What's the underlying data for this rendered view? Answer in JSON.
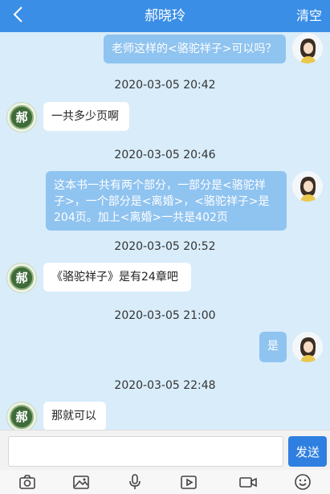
{
  "header": {
    "title": "郝晓玲",
    "clear_label": "清空"
  },
  "messages": [
    {
      "side": "right",
      "text": "老师这样的<骆驼祥子>可以吗？"
    },
    {
      "timestamp": "2020-03-05 20:42",
      "side": "left",
      "avatar_char": "郝",
      "text": "一共多少页啊"
    },
    {
      "timestamp": "2020-03-05 20:46",
      "side": "right",
      "line1": "这本书一共有两个部分，一部分是<骆驼祥",
      "line2": "子>，一个部分是<离婚>，<骆驼祥子>是",
      "line3": "204页。加上<离婚>一共是402页"
    },
    {
      "timestamp": "2020-03-05 20:52",
      "side": "left",
      "avatar_char": "郝",
      "text": "《骆驼祥子》是有24章吧"
    },
    {
      "timestamp": "2020-03-05 21:00",
      "side": "right",
      "text": "是"
    },
    {
      "timestamp": "2020-03-05 22:48",
      "side": "left",
      "avatar_char": "郝",
      "text": "那就可以"
    }
  ],
  "input": {
    "value": "",
    "placeholder": ""
  },
  "send_label": "发送",
  "toolbar_icons": [
    "camera-icon",
    "image-icon",
    "microphone-icon",
    "video-play-icon",
    "video-camera-icon",
    "emoji-icon"
  ],
  "colors": {
    "header": "#3a8ee6",
    "background": "#d8ecfa",
    "bubble_right": "#8fc3f0",
    "send_button": "#2f7fe0"
  }
}
